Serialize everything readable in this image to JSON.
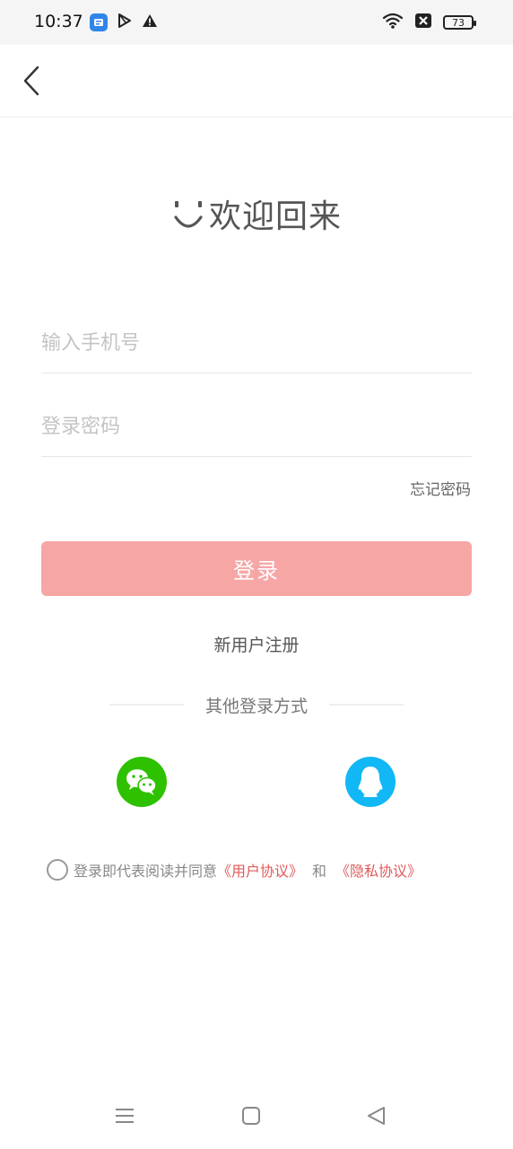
{
  "status_bar": {
    "time": "10:37",
    "battery": "73",
    "icons_left": [
      "app-store-icon",
      "play-store-icon",
      "warning-icon"
    ],
    "icons_right": [
      "wifi-icon",
      "sim-blocked-icon",
      "battery-icon"
    ]
  },
  "nav": {
    "back_icon": "chevron-left-icon"
  },
  "welcome": {
    "title": "欢迎回来",
    "icon": "smile-icon"
  },
  "form": {
    "phone_placeholder": "输入手机号",
    "phone_value": "",
    "password_placeholder": "登录密码",
    "password_value": "",
    "forgot_label": "忘记密码",
    "login_label": "登录",
    "login_color": "#f7a6a6",
    "register_label": "新用户注册"
  },
  "other_login": {
    "label": "其他登录方式",
    "providers": [
      {
        "name": "wechat-icon",
        "color": "#2dc100"
      },
      {
        "name": "qq-icon",
        "color": "#12b7f5"
      }
    ]
  },
  "agreement": {
    "text": "登录即代表阅读并同意",
    "user_agreement": "《用户协议》",
    "and_text": "和",
    "privacy_policy": "《隐私协议》",
    "checked": false,
    "link_color": "#e05a5a"
  },
  "system_nav": {
    "icons": [
      "menu-icon",
      "home-icon",
      "back-triangle-icon"
    ]
  }
}
